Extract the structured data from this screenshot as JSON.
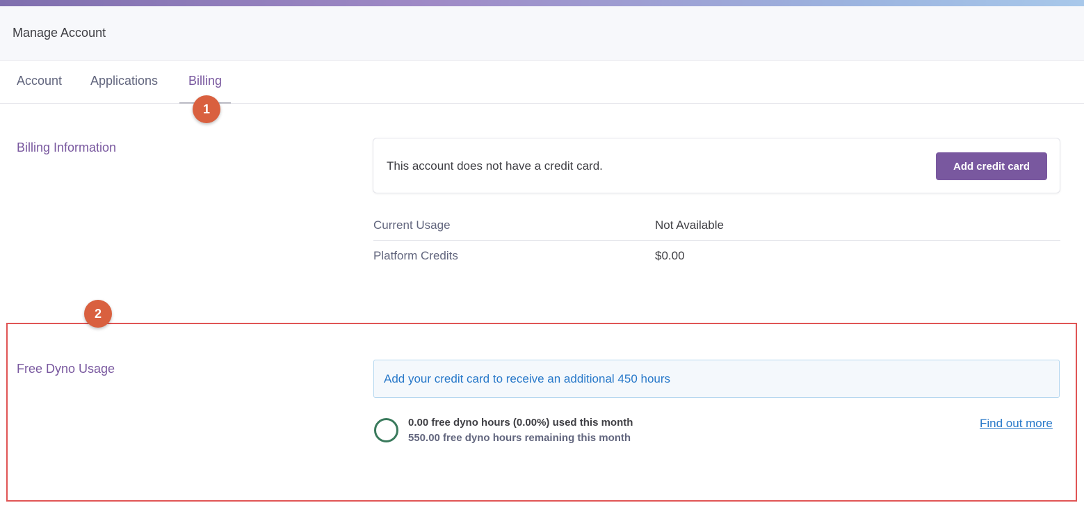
{
  "header": {
    "title": "Manage Account"
  },
  "tabs": [
    {
      "label": "Account",
      "active": false
    },
    {
      "label": "Applications",
      "active": false
    },
    {
      "label": "Billing",
      "active": true
    }
  ],
  "markers": [
    "1",
    "2"
  ],
  "billing": {
    "section_label": "Billing Information",
    "credit_card_message": "This account does not have a credit card.",
    "add_credit_card_label": "Add credit card",
    "usage": [
      {
        "key": "Current Usage",
        "value": "Not Available"
      },
      {
        "key": "Platform Credits",
        "value": "$0.00"
      }
    ]
  },
  "dyno": {
    "section_label": "Free Dyno Usage",
    "banner_text": "Add your credit card to receive an additional 450 hours",
    "used_text": "0.00 free dyno hours (0.00%) used this month",
    "remaining_text": "550.00 free dyno hours remaining this month",
    "used_fraction": 0.0,
    "find_out_more_label": "Find out more"
  },
  "colors": {
    "accent": "#79589f",
    "link": "#2778c9",
    "marker": "#d9603f",
    "highlight_border": "#e05555",
    "ring": "#3a7a5c"
  }
}
